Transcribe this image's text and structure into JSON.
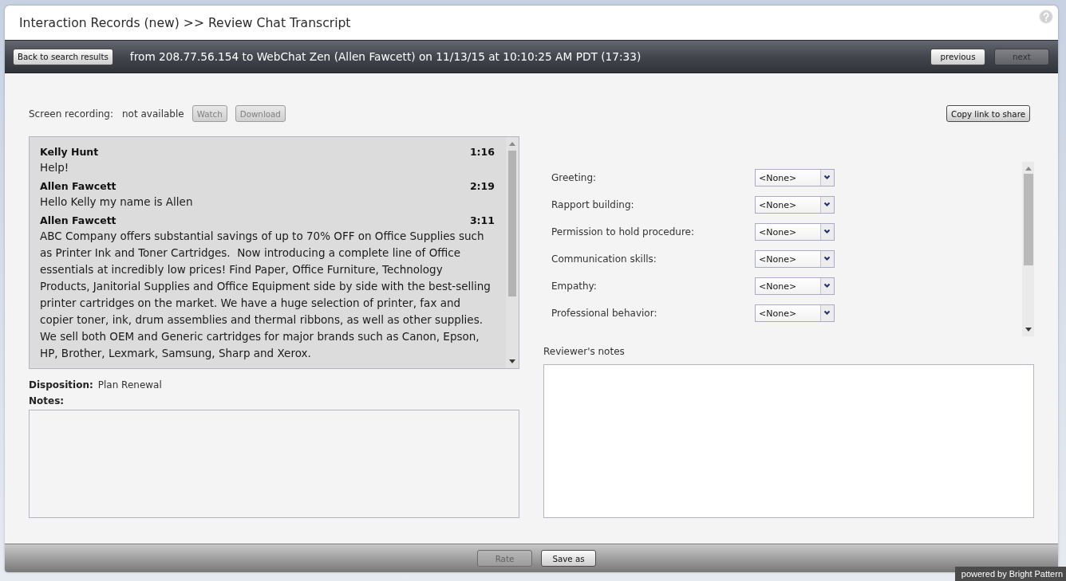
{
  "window": {
    "title": "Interaction Records (new) >> Review Chat Transcript"
  },
  "toolbar": {
    "back_button": {
      "label": "Back to search results",
      "disabled": false
    },
    "summary": "from 208.77.56.154 to WebChat Zen (Allen Fawcett) on 11/13/15 at 10:10:25 AM PDT (17:33)",
    "nav_buttons": [
      {
        "label": "previous",
        "disabled": false
      },
      {
        "label": "next",
        "disabled": true
      }
    ]
  },
  "recording": {
    "label": "Screen recording:",
    "status": "not available",
    "buttons": [
      {
        "label": "Watch",
        "disabled": true
      },
      {
        "label": "Download",
        "disabled": true
      }
    ],
    "share_button": {
      "label": "Copy link to share",
      "disabled": false
    }
  },
  "transcript": {
    "messages": [
      {
        "sender": "Kelly Hunt",
        "time": "1:16",
        "text": "Help!"
      },
      {
        "sender": "Allen Fawcett",
        "time": "2:19",
        "text": "Hello Kelly my name is Allen"
      },
      {
        "sender": "Allen Fawcett",
        "time": "3:11",
        "text": "ABC Company offers substantial savings of up to 70% OFF on Office Supplies such as Printer Ink and Toner Cartridges.  Now introducing a complete line of Office essentials at incredibly low prices! Find Paper, Office Furniture, Technology Products, Janitorial Supplies and Office Equipment side by side with the best-selling printer cartridges on the market. We have a huge selection of printer, fax and copier toner, ink, drum assemblies and thermal ribbons, as well as other supplies. We sell both OEM and Generic cartridges for major brands such as Canon, Epson, HP, Brother, Lexmark, Samsung, Sharp and Xerox."
      }
    ]
  },
  "disposition": {
    "label": "Disposition:",
    "value": "Plan Renewal"
  },
  "notes": {
    "label": "Notes:"
  },
  "evaluation": {
    "items": [
      {
        "label": "Greeting:",
        "value": "<None>"
      },
      {
        "label": "Rapport building:",
        "value": "<None>"
      },
      {
        "label": "Permission to hold procedure:",
        "value": "<None>"
      },
      {
        "label": "Communication skills:",
        "value": "<None>"
      },
      {
        "label": "Empathy:",
        "value": "<None>"
      },
      {
        "label": "Professional behavior:",
        "value": "<None>"
      }
    ]
  },
  "reviewer_notes": {
    "label": "Reviewer's notes"
  },
  "footer": {
    "buttons": [
      {
        "label": "Rate",
        "disabled": true
      },
      {
        "label": "Save as",
        "disabled": false
      }
    ]
  },
  "branding": "powered by Bright Pattern"
}
